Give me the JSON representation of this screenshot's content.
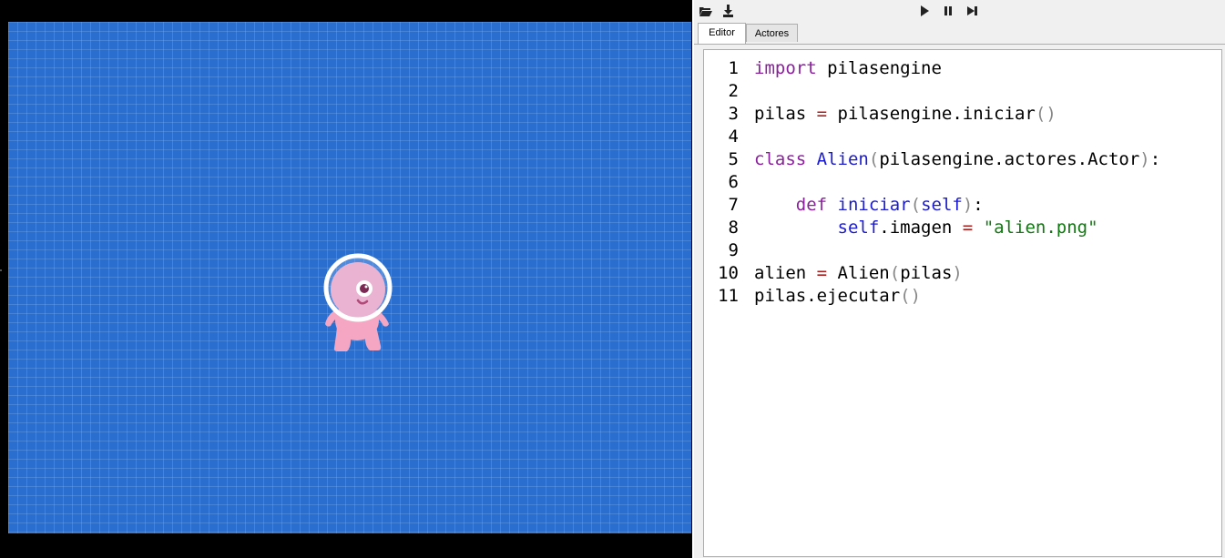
{
  "toolbar": {
    "open_icon": "folder-open-icon",
    "save_icon": "download-icon",
    "play_icon": "play-icon",
    "pause_icon": "pause-icon",
    "step_icon": "step-forward-icon"
  },
  "tabs": [
    {
      "label": "Editor",
      "active": true
    },
    {
      "label": "Actores",
      "active": false
    }
  ],
  "editor": {
    "line_numbers": [
      "1",
      "2",
      "3",
      "4",
      "5",
      "6",
      "7",
      "8",
      "9",
      "10",
      "11"
    ],
    "lines": [
      [
        "import",
        " pilasengine"
      ],
      [],
      [
        "pilas ",
        "=",
        " pilasengine.iniciar",
        "()"
      ],
      [],
      [
        "class",
        " ",
        "Alien",
        "(",
        "pilasengine.actores.Actor",
        ")",
        ":"
      ],
      [],
      [
        "    ",
        "def",
        " ",
        "iniciar",
        "(",
        "self",
        ")",
        ":"
      ],
      [
        "        ",
        "self",
        ".imagen ",
        "=",
        " ",
        "\"alien.png\""
      ],
      [],
      [
        "alien ",
        "=",
        " Alien",
        "(",
        "pilas",
        ")"
      ],
      [
        "pilas.ejecutar",
        "()"
      ]
    ]
  },
  "colors": {
    "canvas_bg": "#2a6fcf",
    "keyword": "#8b1f9e",
    "name": "#1b1bd4",
    "string": "#127812",
    "operator": "#b01d1d"
  },
  "scene": {
    "actor_icon": "alien-sprite"
  }
}
